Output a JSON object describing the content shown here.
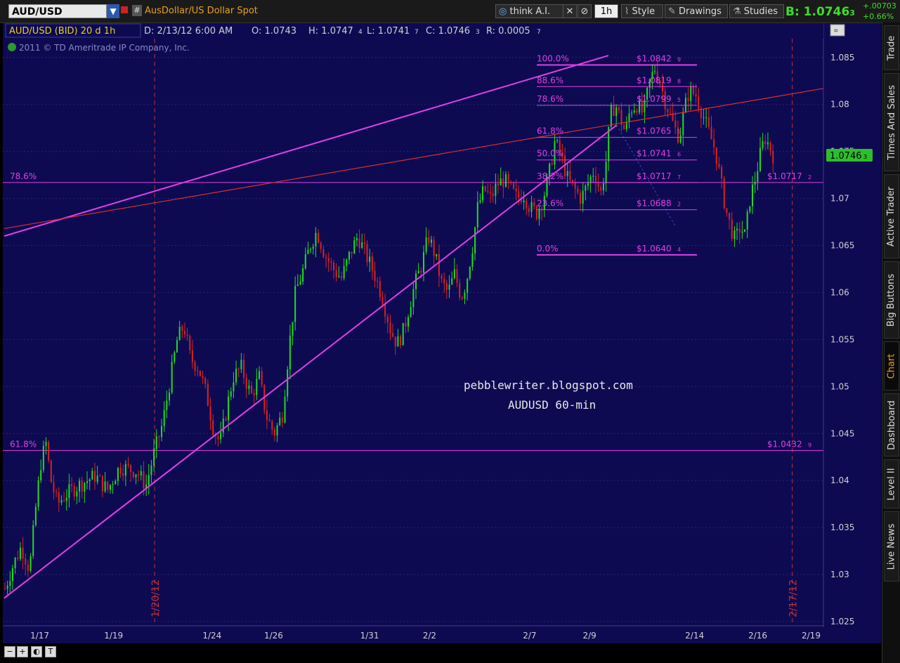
{
  "toolbar": {
    "symbol": "AUD/USD",
    "symbol_arrow": "▼",
    "hash": "#",
    "description": "AusDollar/US Dollar Spot",
    "think_ai": "think A.I.",
    "timeframe": "1h",
    "style": "Style",
    "drawings": "Drawings",
    "studies": "Studies",
    "bid": "B: 1.0746",
    "bid_sub": "3",
    "change": "+.00703",
    "change_pct": "+0.66%"
  },
  "sidebar": {
    "tabs": [
      "Trade",
      "Times And Sales",
      "Active Trader",
      "Big Buttons",
      "Chart",
      "Dashboard",
      "Level II",
      "Live News"
    ],
    "active": "Chart"
  },
  "header": {
    "title": "AUD/USD (BID) 20 d 1h",
    "date": "D: 2/13/12 6:00 AM",
    "open": "O: 1.0743",
    "high": "H: 1.0747",
    "high_sub": "4",
    "low": "L: 1.0741",
    "low_sub": "7",
    "close": "C: 1.0746",
    "close_sub": "3",
    "range": "R: 0.0005",
    "range_sub": "7",
    "copyright": "2011 © TD Ameritrade IP Company, Inc."
  },
  "colors": {
    "background": "#0d0a52",
    "grid": "#26246e",
    "magenta": "#e040e0",
    "red": "#dd2020",
    "green": "#20dd20",
    "text": "#d0d0d0",
    "price_tag": "#2bbf2b"
  },
  "chart_data": {
    "type": "candlestick",
    "title": "AUD/USD (BID) 20 d 1h",
    "ylim": [
      1.025,
      1.087
    ],
    "y_ticks": [
      "1.025",
      "1.03",
      "1.035",
      "1.04",
      "1.045",
      "1.05",
      "1.055",
      "1.06",
      "1.065",
      "1.07",
      "1.075",
      "1.08",
      "1.085"
    ],
    "x_ticks": [
      "1/17",
      "1/19",
      "1/24",
      "1/26",
      "1/31",
      "2/2",
      "2/7",
      "2/9",
      "2/14",
      "2/16",
      "2/19"
    ],
    "vertical_markers": [
      "1/20/12",
      "2/17/12"
    ],
    "current_price": "1.0746",
    "current_price_sub": "3",
    "watermark": [
      "pebblewriter.blogspot.com",
      "AUDUSD 60-min"
    ],
    "fib_retracement": [
      {
        "level": "100.0%",
        "price": "1.0842",
        "price_sub": "9",
        "label": "$1.0842"
      },
      {
        "level": "88.6%",
        "price": "1.0819",
        "price_sub": "8",
        "label": "$1.0819"
      },
      {
        "level": "78.6%",
        "price": "1.0799",
        "price_sub": "5",
        "label": "$1.0799"
      },
      {
        "level": "61.8%",
        "price": "1.0765",
        "price_sub": "5",
        "label": "$1.0765"
      },
      {
        "level": "50.0%",
        "price": "1.0741",
        "price_sub": "6",
        "label": "$1.0741"
      },
      {
        "level": "38.2%",
        "price": "1.0717",
        "price_sub": "7",
        "label": "$1.0717"
      },
      {
        "level": "23.6%",
        "price": "1.0688",
        "price_sub": "2",
        "label": "$1.0688"
      },
      {
        "level": "0.0%",
        "price": "1.0640",
        "price_sub": "4",
        "label": "$1.0640"
      }
    ],
    "horizontal_levels": [
      {
        "level": "78.6%",
        "price": 1.0717,
        "label": "$1.0717",
        "label_sub": "2"
      },
      {
        "level": "61.8%",
        "price": 1.0432,
        "label": "$1.0432",
        "label_sub": "9"
      }
    ],
    "trendlines": [
      {
        "name": "lower trendline",
        "color": "magenta",
        "from": [
          0.0,
          1.0275
        ],
        "to": [
          0.748,
          1.0778
        ]
      },
      {
        "name": "upper trendline",
        "color": "magenta",
        "from": [
          0.0,
          1.066
        ],
        "to": [
          0.738,
          1.0852
        ]
      },
      {
        "name": "red trendline",
        "color": "red",
        "from": [
          0.0,
          1.0668
        ],
        "to": [
          1.0,
          1.0817
        ]
      }
    ],
    "price_path": [
      [
        0.0,
        1.0285
      ],
      [
        0.01,
        1.031
      ],
      [
        0.02,
        1.033
      ],
      [
        0.03,
        1.0305
      ],
      [
        0.038,
        1.0375
      ],
      [
        0.044,
        1.042
      ],
      [
        0.05,
        1.044
      ],
      [
        0.056,
        1.04
      ],
      [
        0.064,
        1.0375
      ],
      [
        0.074,
        1.0385
      ],
      [
        0.09,
        1.0395
      ],
      [
        0.11,
        1.0405
      ],
      [
        0.125,
        1.039
      ],
      [
        0.14,
        1.0415
      ],
      [
        0.16,
        1.041
      ],
      [
        0.172,
        1.0395
      ],
      [
        0.182,
        1.043
      ],
      [
        0.192,
        1.046
      ],
      [
        0.2,
        1.05
      ],
      [
        0.21,
        1.055
      ],
      [
        0.218,
        1.0565
      ],
      [
        0.226,
        1.053
      ],
      [
        0.236,
        1.052
      ],
      [
        0.246,
        1.049
      ],
      [
        0.254,
        1.0455
      ],
      [
        0.262,
        1.044
      ],
      [
        0.27,
        1.0475
      ],
      [
        0.278,
        1.051
      ],
      [
        0.288,
        1.052
      ],
      [
        0.3,
        1.049
      ],
      [
        0.31,
        1.051
      ],
      [
        0.318,
        1.047
      ],
      [
        0.328,
        1.045
      ],
      [
        0.338,
        1.047
      ],
      [
        0.346,
        1.054
      ],
      [
        0.354,
        1.06
      ],
      [
        0.362,
        1.062
      ],
      [
        0.372,
        1.065
      ],
      [
        0.38,
        1.0665
      ],
      [
        0.39,
        1.064
      ],
      [
        0.4,
        1.0625
      ],
      [
        0.41,
        1.0615
      ],
      [
        0.42,
        1.064
      ],
      [
        0.43,
        1.066
      ],
      [
        0.44,
        1.064
      ],
      [
        0.45,
        1.062
      ],
      [
        0.46,
        1.0595
      ],
      [
        0.47,
        1.056
      ],
      [
        0.478,
        1.0545
      ],
      [
        0.486,
        1.056
      ],
      [
        0.494,
        1.059
      ],
      [
        0.5,
        1.061
      ],
      [
        0.508,
        1.063
      ],
      [
        0.516,
        1.066
      ],
      [
        0.524,
        1.064
      ],
      [
        0.532,
        1.061
      ],
      [
        0.54,
        1.06
      ],
      [
        0.548,
        1.062
      ],
      [
        0.556,
        1.0595
      ],
      [
        0.562,
        1.061
      ],
      [
        0.57,
        1.065
      ],
      [
        0.576,
        1.069
      ],
      [
        0.584,
        1.071
      ],
      [
        0.592,
        1.07
      ],
      [
        0.6,
        1.0715
      ],
      [
        0.608,
        1.072
      ],
      [
        0.616,
        1.071
      ],
      [
        0.624,
        1.07
      ],
      [
        0.632,
        1.0705
      ],
      [
        0.64,
        1.069
      ],
      [
        0.648,
        1.0685
      ],
      [
        0.656,
        1.07
      ],
      [
        0.664,
        1.073
      ],
      [
        0.67,
        1.076
      ],
      [
        0.678,
        1.0745
      ],
      [
        0.686,
        1.072
      ],
      [
        0.694,
        1.071
      ],
      [
        0.702,
        1.07
      ],
      [
        0.71,
        1.0715
      ],
      [
        0.718,
        1.073
      ],
      [
        0.726,
        1.0705
      ],
      [
        0.732,
        1.0735
      ],
      [
        0.738,
        1.079
      ],
      [
        0.744,
        1.08
      ],
      [
        0.75,
        1.0785
      ],
      [
        0.756,
        1.077
      ],
      [
        0.762,
        1.0795
      ],
      [
        0.77,
        1.08
      ],
      [
        0.778,
        1.079
      ],
      [
        0.786,
        1.0825
      ],
      [
        0.792,
        1.0838
      ],
      [
        0.798,
        1.0825
      ],
      [
        0.804,
        1.0805
      ],
      [
        0.81,
        1.079
      ],
      [
        0.816,
        1.0775
      ],
      [
        0.822,
        1.0765
      ],
      [
        0.828,
        1.0795
      ],
      [
        0.834,
        1.0815
      ],
      [
        0.842,
        1.081
      ],
      [
        0.85,
        1.079
      ],
      [
        0.858,
        1.077
      ],
      [
        0.866,
        1.075
      ],
      [
        0.872,
        1.072
      ],
      [
        0.878,
        1.069
      ],
      [
        0.884,
        1.067
      ],
      [
        0.89,
        1.0655
      ],
      [
        0.896,
        1.067
      ],
      [
        0.902,
        1.066
      ],
      [
        0.908,
        1.07
      ],
      [
        0.914,
        1.072
      ],
      [
        0.92,
        1.0745
      ],
      [
        0.926,
        1.0765
      ],
      [
        0.932,
        1.0755
      ],
      [
        0.936,
        1.0746
      ]
    ]
  }
}
